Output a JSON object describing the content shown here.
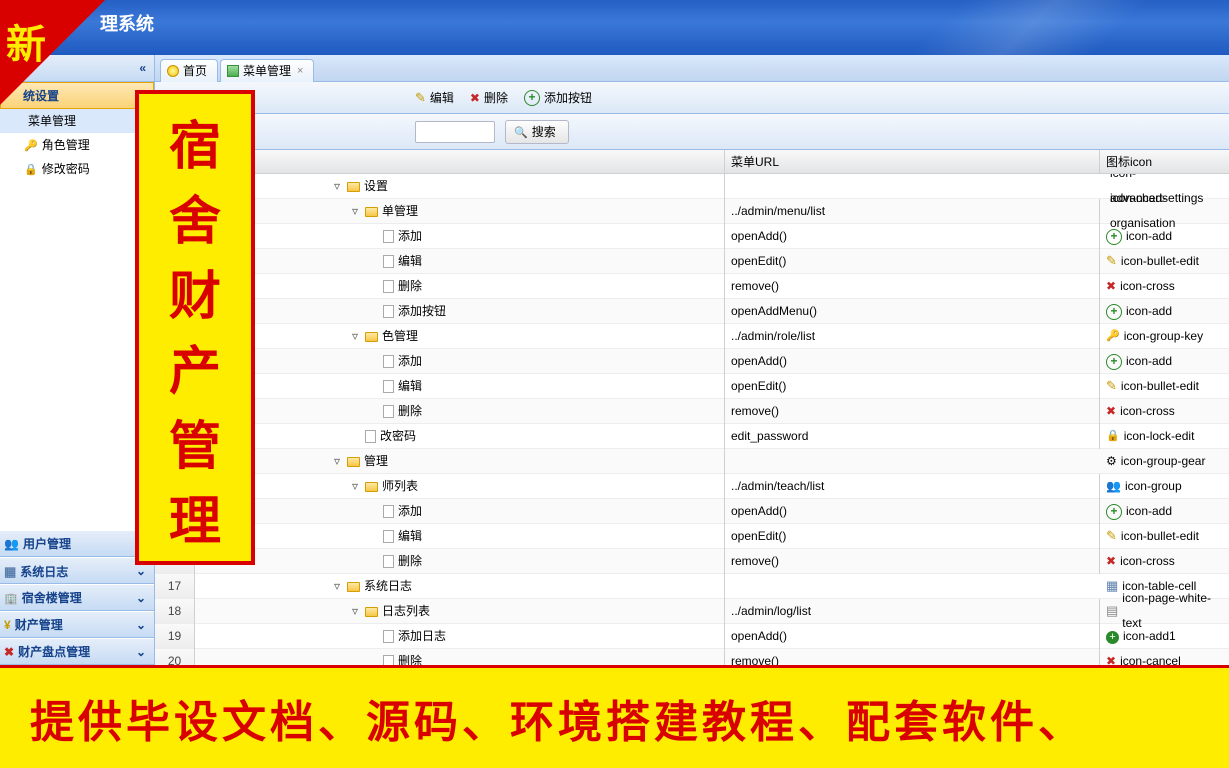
{
  "header": {
    "title": "理系统"
  },
  "corner": "新",
  "overlay_vertical": [
    "宿",
    "舍",
    "财",
    "产",
    "管",
    "理"
  ],
  "banner": "提供毕设文档、源码、环境搭建教程、配套软件、",
  "sidebar": {
    "collapse_glyph": "«",
    "accordion": [
      {
        "label": "统设置",
        "icon": "gear",
        "active": true
      },
      {
        "label": "用户管理",
        "icon": "group"
      },
      {
        "label": "系统日志",
        "icon": "table"
      },
      {
        "label": "宿舍楼管理",
        "icon": "build"
      },
      {
        "label": "财产管理",
        "icon": "money"
      },
      {
        "label": "财产盘点管理",
        "icon": "cross"
      }
    ],
    "tree": [
      {
        "label": "菜单管理",
        "icon": "org",
        "selected": true
      },
      {
        "label": "角色管理",
        "icon": "key"
      },
      {
        "label": "修改密码",
        "icon": "lock"
      }
    ]
  },
  "tabs": [
    {
      "label": "首页",
      "icon": "bulb",
      "closable": false
    },
    {
      "label": "菜单管理",
      "icon": "org",
      "closable": true
    }
  ],
  "toolbar": {
    "edit": "编辑",
    "delete": "删除",
    "addbtn": "添加按钮"
  },
  "search": {
    "btn": "搜索"
  },
  "columns": {
    "name": "",
    "url": "菜单URL",
    "icon": "图标icon"
  },
  "rows": [
    {
      "n": "",
      "indent": 0,
      "exp": "▿",
      "folder": true,
      "name": "设置",
      "url": "",
      "icon": "icon-advancedsettings",
      "ico": "wrench"
    },
    {
      "n": "",
      "indent": 1,
      "exp": "▿",
      "folder": true,
      "name": "单管理",
      "url": "../admin/menu/list",
      "icon": "icon-chart-organisation",
      "ico": "org"
    },
    {
      "n": "",
      "indent": 2,
      "exp": "",
      "folder": false,
      "name": "添加",
      "url": "openAdd()",
      "icon": "icon-add",
      "ico": "add"
    },
    {
      "n": "",
      "indent": 2,
      "exp": "",
      "folder": false,
      "name": "编辑",
      "url": "openEdit()",
      "icon": "icon-bullet-edit",
      "ico": "edit"
    },
    {
      "n": "",
      "indent": 2,
      "exp": "",
      "folder": false,
      "name": "删除",
      "url": "remove()",
      "icon": "icon-cross",
      "ico": "cross"
    },
    {
      "n": "",
      "indent": 2,
      "exp": "",
      "folder": false,
      "name": "添加按钮",
      "url": "openAddMenu()",
      "icon": "icon-add",
      "ico": "add"
    },
    {
      "n": "",
      "indent": 1,
      "exp": "▿",
      "folder": true,
      "name": "色管理",
      "url": "../admin/role/list",
      "icon": "icon-group-key",
      "ico": "key"
    },
    {
      "n": "",
      "indent": 2,
      "exp": "",
      "folder": false,
      "name": "添加",
      "url": "openAdd()",
      "icon": "icon-add",
      "ico": "add"
    },
    {
      "n": "",
      "indent": 2,
      "exp": "",
      "folder": false,
      "name": "编辑",
      "url": "openEdit()",
      "icon": "icon-bullet-edit",
      "ico": "edit"
    },
    {
      "n": "",
      "indent": 2,
      "exp": "",
      "folder": false,
      "name": "删除",
      "url": "remove()",
      "icon": "icon-cross",
      "ico": "cross"
    },
    {
      "n": "",
      "indent": 1,
      "exp": "",
      "folder": false,
      "name": "改密码",
      "url": "edit_password",
      "icon": "icon-lock-edit",
      "ico": "lock"
    },
    {
      "n": "",
      "indent": 0,
      "exp": "▿",
      "folder": true,
      "name": "管理",
      "url": "",
      "icon": "icon-group-gear",
      "ico": "gear"
    },
    {
      "n": "",
      "indent": 1,
      "exp": "▿",
      "folder": true,
      "name": "师列表",
      "url": "../admin/teach/list",
      "icon": "icon-group",
      "ico": "group"
    },
    {
      "n": "",
      "indent": 2,
      "exp": "",
      "folder": false,
      "name": "添加",
      "url": "openAdd()",
      "icon": "icon-add",
      "ico": "add"
    },
    {
      "n": "",
      "indent": 2,
      "exp": "",
      "folder": false,
      "name": "编辑",
      "url": "openEdit()",
      "icon": "icon-bullet-edit",
      "ico": "edit"
    },
    {
      "n": "16",
      "indent": 2,
      "exp": "",
      "folder": false,
      "name": "删除",
      "url": "remove()",
      "icon": "icon-cross",
      "ico": "cross"
    },
    {
      "n": "17",
      "indent": 0,
      "exp": "▿",
      "folder": true,
      "name": "系统日志",
      "url": "",
      "icon": "icon-table-cell",
      "ico": "table"
    },
    {
      "n": "18",
      "indent": 1,
      "exp": "▿",
      "folder": true,
      "name": "日志列表",
      "url": "../admin/log/list",
      "icon": "icon-page-white-text",
      "ico": "pgtxt"
    },
    {
      "n": "19",
      "indent": 2,
      "exp": "",
      "folder": false,
      "name": "添加日志",
      "url": "openAdd()",
      "icon": "icon-add1",
      "ico": "add1"
    },
    {
      "n": "20",
      "indent": 2,
      "exp": "",
      "folder": false,
      "name": "删除",
      "url": "remove()",
      "icon": "icon-cancel",
      "ico": "cancel"
    }
  ]
}
